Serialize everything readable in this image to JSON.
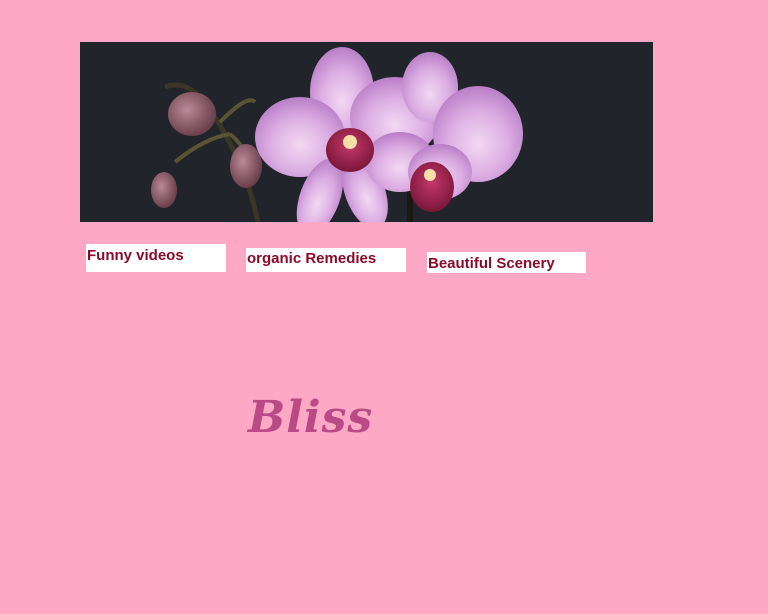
{
  "banner": {
    "image": "orchid-flower-image"
  },
  "nav": {
    "items": [
      {
        "label": "Funny videos"
      },
      {
        "label": "organic Remedies"
      },
      {
        "label": "Beautiful Scenery"
      }
    ]
  },
  "main": {
    "title": "Bliss"
  },
  "colors": {
    "background": "#ffa8c5",
    "banner_background": "#22242b",
    "link_text": "#8b0a2a",
    "link_background": "#ffffff",
    "title_text": "#b94a86"
  }
}
